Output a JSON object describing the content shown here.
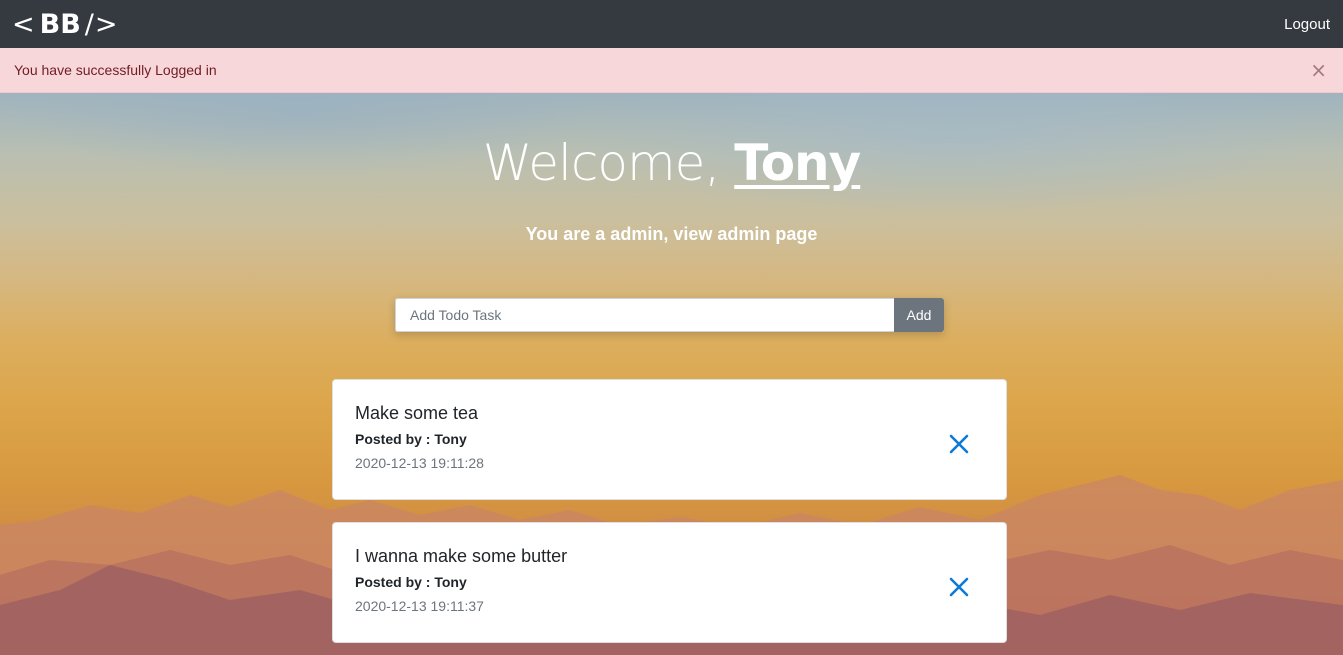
{
  "navbar": {
    "brand_left": "<",
    "brand_text": "BB",
    "brand_right": "/>",
    "logout_label": "Logout"
  },
  "alert": {
    "message": "You have successfully Logged in",
    "close_label": "×"
  },
  "hero": {
    "welcome_prefix": "Welcome, ",
    "username": "Tony",
    "admin_prefix": "You are a admin, ",
    "admin_link": "view admin page"
  },
  "todo_form": {
    "placeholder": "Add Todo Task",
    "value": "",
    "add_label": "Add"
  },
  "todos": [
    {
      "title": "Make some tea",
      "posted_by_label": "Posted by : ",
      "author": "Tony",
      "timestamp": "2020-12-13 19:11:28"
    },
    {
      "title": "I wanna make some butter",
      "posted_by_label": "Posted by : ",
      "author": "Tony",
      "timestamp": "2020-12-13 19:11:37"
    }
  ],
  "colors": {
    "navbar_bg": "#343a40",
    "alert_bg": "#f8d7da",
    "alert_text": "#721c24",
    "delete_icon": "#0d7ad8",
    "add_button": "#6c757d"
  },
  "icons": {
    "alert_close": "close-icon",
    "todo_delete": "close-icon"
  }
}
